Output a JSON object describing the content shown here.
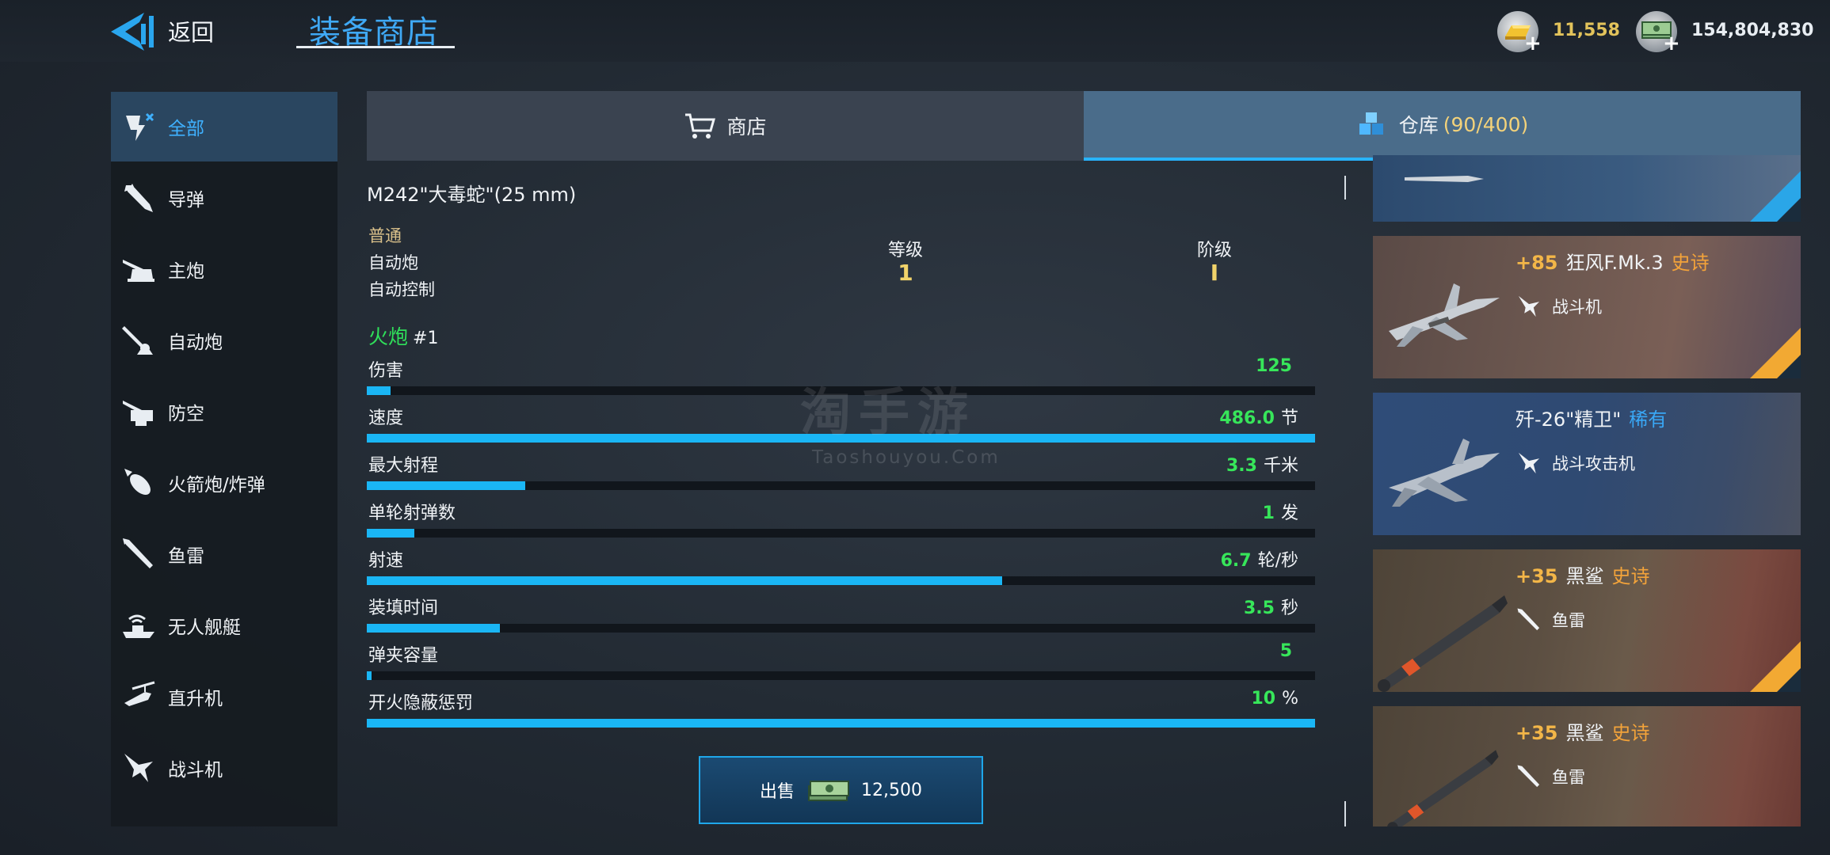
{
  "header": {
    "back_label": "返回",
    "title": "装备商店",
    "currencies": [
      {
        "icon": "gold-bar-icon",
        "amount": "11,558",
        "plus": "+"
      },
      {
        "icon": "cash-stack-icon",
        "amount": "154,804,830",
        "plus": "+"
      }
    ]
  },
  "sidebar": {
    "items": [
      {
        "label": "全部",
        "icon": "all-icon",
        "active": true
      },
      {
        "label": "导弹",
        "icon": "missile-icon"
      },
      {
        "label": "主炮",
        "icon": "main-gun-icon"
      },
      {
        "label": "自动炮",
        "icon": "autocannon-icon"
      },
      {
        "label": "防空",
        "icon": "anti-air-icon"
      },
      {
        "label": "火箭炮/炸弹",
        "icon": "rocket-bomb-icon"
      },
      {
        "label": "鱼雷",
        "icon": "torpedo-icon"
      },
      {
        "label": "无人舰艇",
        "icon": "drone-boat-icon"
      },
      {
        "label": "直升机",
        "icon": "helicopter-icon"
      },
      {
        "label": "战斗机",
        "icon": "fighter-jet-icon"
      }
    ]
  },
  "tabs": {
    "shop": {
      "label": "商店",
      "icon": "cart-icon"
    },
    "storage": {
      "label": "仓库",
      "count": "(90/400)",
      "icon": "boxes-icon"
    }
  },
  "detail": {
    "name": "M242\"大毒蛇\"(25 mm)",
    "rarity": "普通",
    "type": "自动炮",
    "control": "自动控制",
    "level_label": "等级",
    "level_value": "1",
    "stage_label": "阶级",
    "stage_value": "I",
    "section_name": "火炮",
    "section_num": "#1",
    "stats": [
      {
        "label": "伤害",
        "value": "125",
        "unit": "",
        "fill": 0.025
      },
      {
        "label": "速度",
        "value": "486.0",
        "unit": "节",
        "fill": 1.0
      },
      {
        "label": "最大射程",
        "value": "3.3",
        "unit": "千米",
        "fill": 0.167
      },
      {
        "label": "单轮射弹数",
        "value": "1",
        "unit": "发",
        "fill": 0.05
      },
      {
        "label": "射速",
        "value": "6.7",
        "unit": "轮/秒",
        "fill": 0.67
      },
      {
        "label": "装填时间",
        "value": "3.5",
        "unit": "秒",
        "fill": 0.14
      },
      {
        "label": "弹夹容量",
        "value": "5",
        "unit": "",
        "fill": 0.005
      },
      {
        "label": "开火隐蔽惩罚",
        "value": "10",
        "unit": "%",
        "fill": 1.0
      }
    ],
    "sell": {
      "label": "出售",
      "price": "12,500",
      "icon": "cash-stack-icon"
    }
  },
  "inventory": [
    {
      "bonus": "",
      "name": "",
      "rarity": "",
      "type": ""
    },
    {
      "bonus": "+85",
      "name": "狂风F.Mk.3",
      "rarity": "史诗",
      "rarity_kind": "epic",
      "type": "战斗机",
      "type_icon": "fighter-jet-icon",
      "pic": "tornado-jet"
    },
    {
      "bonus": "",
      "name": "歼-26\"精卫\"",
      "rarity": "稀有",
      "rarity_kind": "rare",
      "type": "战斗攻击机",
      "type_icon": "fighter-jet-icon",
      "pic": "j26-jet"
    },
    {
      "bonus": "+35",
      "name": "黑鲨",
      "rarity": "史诗",
      "rarity_kind": "epic",
      "type": "鱼雷",
      "type_icon": "torpedo-icon",
      "pic": "torpedo"
    },
    {
      "bonus": "+35",
      "name": "黑鲨",
      "rarity": "史诗",
      "rarity_kind": "epic",
      "type": "鱼雷",
      "type_icon": "torpedo-icon",
      "pic": "torpedo"
    }
  ],
  "watermark": {
    "main": "淘手游",
    "sub": "Taoshouyou.Com"
  },
  "colors": {
    "accent": "#3fa9f5",
    "stat_value": "#37e65a",
    "bar_fill": "#1ab6f5",
    "epic": "#f3a33a",
    "rare": "#39a7f5",
    "gold_text": "#e2c35b"
  }
}
